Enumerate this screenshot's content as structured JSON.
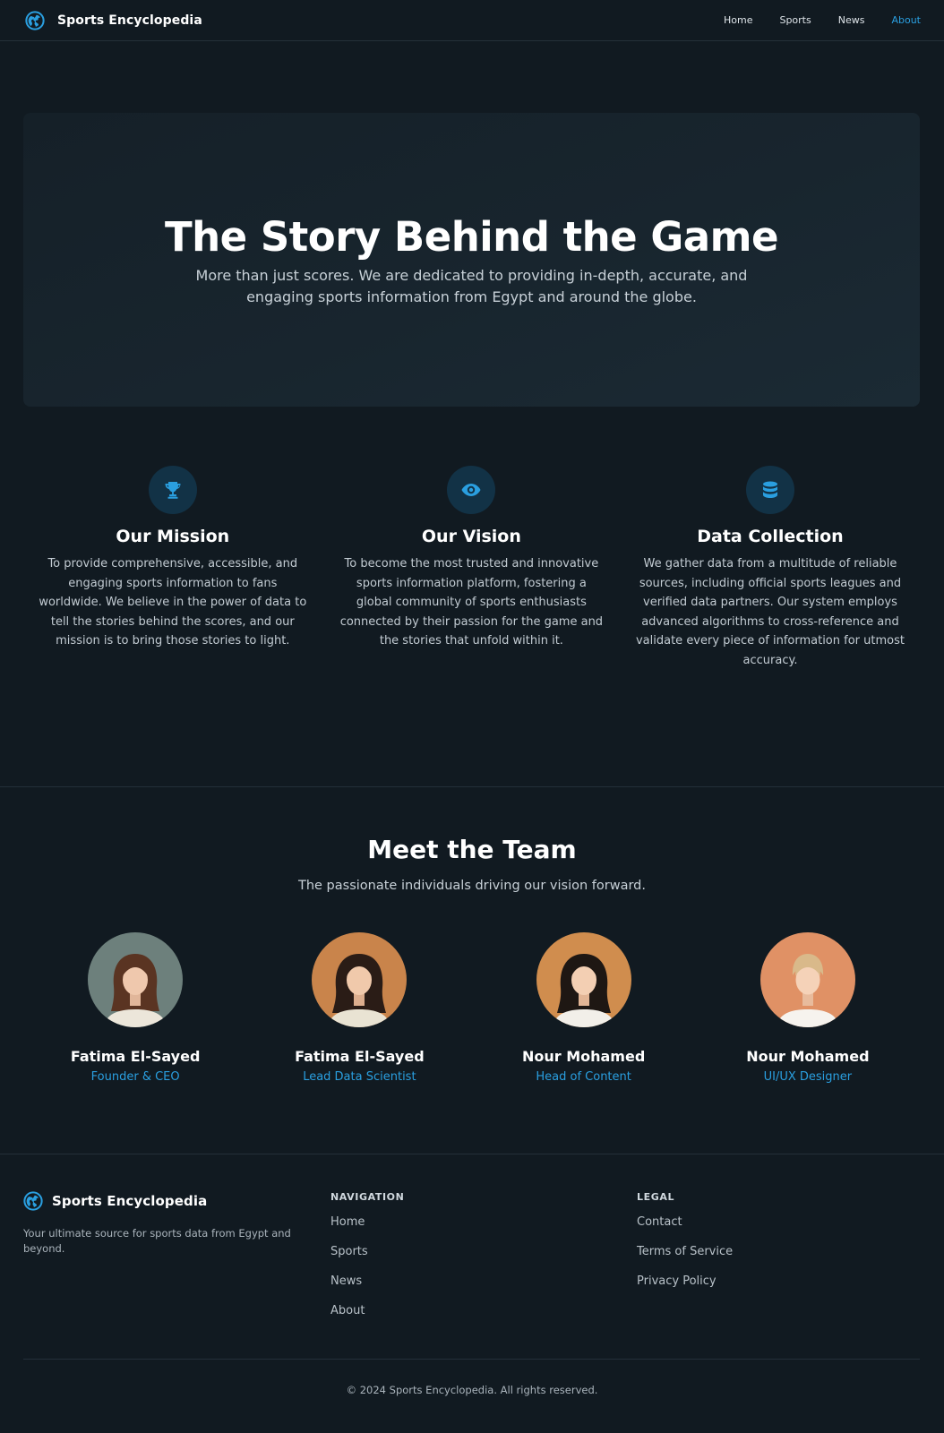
{
  "nav": {
    "brand": "Sports Encyclopedia",
    "logo_icon": "globe-icon",
    "links": [
      {
        "label": "Home",
        "active": false
      },
      {
        "label": "Sports",
        "active": false
      },
      {
        "label": "News",
        "active": false
      },
      {
        "label": "About",
        "active": true
      }
    ]
  },
  "hero": {
    "title": "The Story Behind the Game",
    "subtitle": "More than just scores. We are dedicated to providing in-depth, accurate, and engaging sports information from Egypt and around the globe."
  },
  "features": [
    {
      "icon": "trophy-icon",
      "title": "Our Mission",
      "text": "To provide comprehensive, accessible, and engaging sports information to fans worldwide. We believe in the power of data to tell the stories behind the scores, and our mission is to bring those stories to light."
    },
    {
      "icon": "eye-icon",
      "title": "Our Vision",
      "text": "To become the most trusted and innovative sports information platform, fostering a global community of sports enthusiasts connected by their passion for the game and the stories that unfold within it."
    },
    {
      "icon": "database-icon",
      "title": "Data Collection",
      "text": "We gather data from a multitude of reliable sources, including official sports leagues and verified data partners. Our system employs advanced algorithms to cross-reference and validate every piece of information for utmost accuracy."
    }
  ],
  "team": {
    "title": "Meet the Team",
    "subtitle": "The passionate individuals driving our vision forward.",
    "members": [
      {
        "name": "Fatima El-Sayed",
        "role": "Founder & CEO"
      },
      {
        "name": "Fatima El-Sayed",
        "role": "Lead Data Scientist"
      },
      {
        "name": "Nour Mohamed",
        "role": "Head of Content"
      },
      {
        "name": "Nour Mohamed",
        "role": "UI/UX Designer"
      }
    ]
  },
  "footer": {
    "brand": "Sports Encyclopedia",
    "tagline": "Your ultimate source for sports data from Egypt and beyond.",
    "navigation": {
      "heading": "NAVIGATION",
      "links": [
        "Home",
        "Sports",
        "News",
        "About"
      ]
    },
    "legal": {
      "heading": "LEGAL",
      "links": [
        "Contact",
        "Terms of Service",
        "Privacy Policy"
      ]
    },
    "copyright": "© 2024 Sports Encyclopedia. All rights reserved."
  },
  "colors": {
    "background": "#111a21",
    "accent": "#2a9fe0",
    "icon_circle": "#123246"
  }
}
